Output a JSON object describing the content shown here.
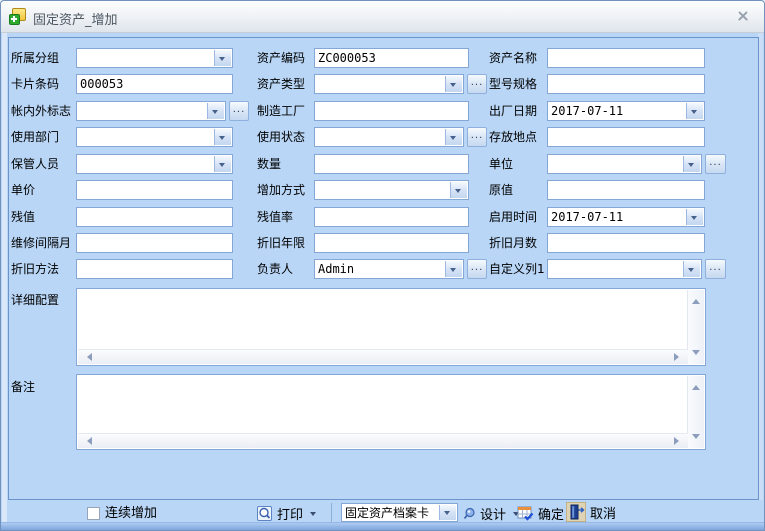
{
  "window": {
    "title": "固定资产_增加"
  },
  "ui": {
    "dots": "..."
  },
  "colors": {
    "background": "#b9d6f6",
    "panel_border": "#6b95ca",
    "input_border": "#84a7d8",
    "title_text": "#4d5761"
  },
  "form": {
    "fields": {
      "group": {
        "label": "所属分组",
        "value": ""
      },
      "asset_code": {
        "label": "资产编码",
        "value": "ZC000053"
      },
      "asset_name": {
        "label": "资产名称",
        "value": ""
      },
      "card_barcode": {
        "label": "卡片条码",
        "value": "000053"
      },
      "asset_type": {
        "label": "资产类型",
        "value": ""
      },
      "model_spec": {
        "label": "型号规格",
        "value": ""
      },
      "account_flag": {
        "label": "帐内外标志",
        "value": ""
      },
      "manufacturer": {
        "label": "制造工厂",
        "value": ""
      },
      "manufacture_date": {
        "label": "出厂日期",
        "value": "2017-07-11"
      },
      "use_department": {
        "label": "使用部门",
        "value": ""
      },
      "use_status": {
        "label": "使用状态",
        "value": ""
      },
      "storage_location": {
        "label": "存放地点",
        "value": ""
      },
      "custodian": {
        "label": "保管人员",
        "value": ""
      },
      "quantity": {
        "label": "数量",
        "value": ""
      },
      "unit": {
        "label": "单位",
        "value": ""
      },
      "unit_price": {
        "label": "单价",
        "value": ""
      },
      "add_method": {
        "label": "增加方式",
        "value": ""
      },
      "original_value": {
        "label": "原值",
        "value": ""
      },
      "residual_value": {
        "label": "残值",
        "value": ""
      },
      "residual_rate": {
        "label": "残值率",
        "value": ""
      },
      "start_date": {
        "label": "启用时间",
        "value": "2017-07-11"
      },
      "maintenance_interval": {
        "label": "维修间隔月",
        "value": ""
      },
      "depreciation_years": {
        "label": "折旧年限",
        "value": ""
      },
      "depreciation_months": {
        "label": "折旧月数",
        "value": ""
      },
      "depreciation_method": {
        "label": "折旧方法",
        "value": ""
      },
      "manager": {
        "label": "负责人",
        "value": "Admin"
      },
      "custom_column1": {
        "label": "自定义列1",
        "value": ""
      },
      "detail_config": {
        "label": "详细配置",
        "value": ""
      },
      "remarks": {
        "label": "备注",
        "value": ""
      }
    }
  },
  "footer": {
    "continuous_add": {
      "label": "连续增加",
      "checked": false
    },
    "print": {
      "label": "打印"
    },
    "template": {
      "value": "固定资产档案卡"
    },
    "design": {
      "label": "设计"
    },
    "ok": {
      "label": "确定"
    },
    "cancel": {
      "label": "取消"
    }
  }
}
